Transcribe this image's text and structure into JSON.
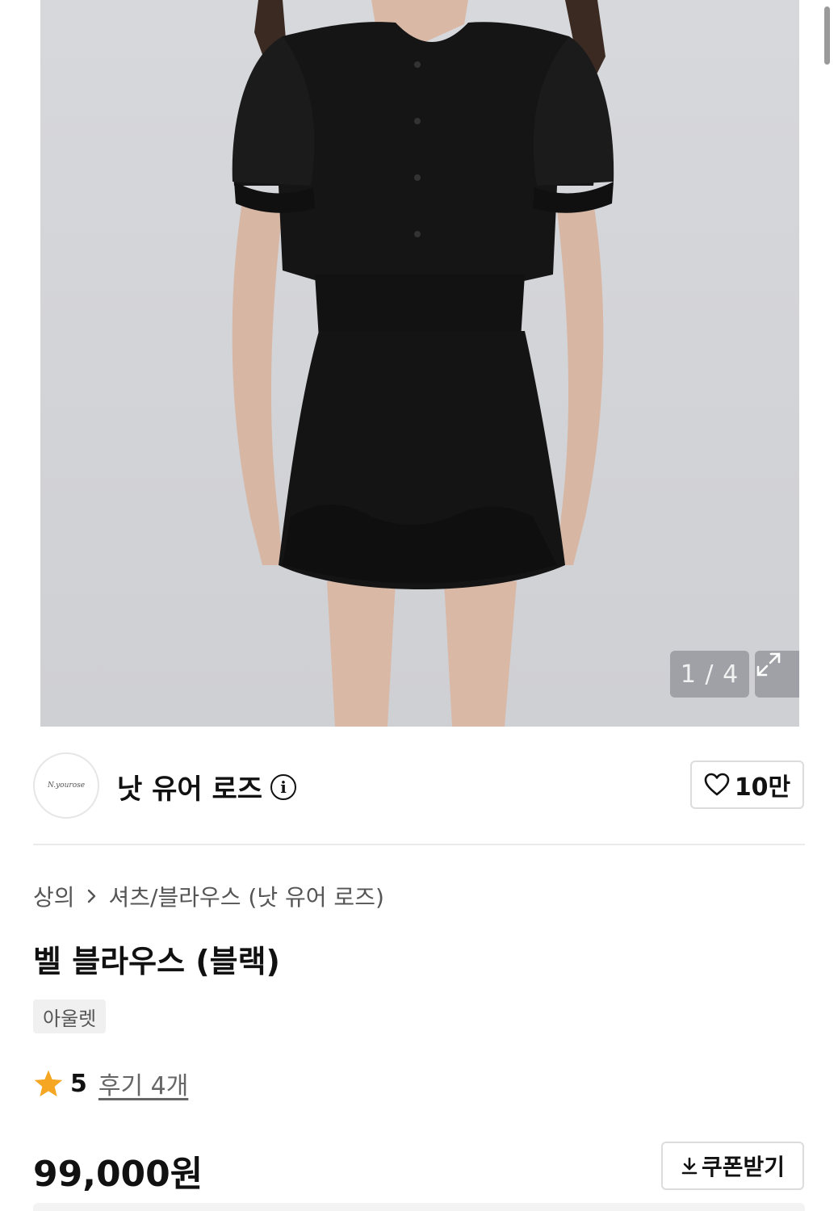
{
  "gallery": {
    "page_indicator": "1 / 4",
    "expand_icon": "expand-arrows-icon"
  },
  "brand": {
    "logo_text": "N.yourose",
    "name": "낫 유어 로즈",
    "info_icon": "info-icon",
    "likes": "10만",
    "like_icon": "heart-outline-icon"
  },
  "product": {
    "breadcrumb": [
      "상의",
      "셔츠/블라우스 (낫 유어 로즈)"
    ],
    "breadcrumb_separator_icon": "chevron-right-icon",
    "title": "벨 블라우스 (블랙)",
    "badge": "아울렛",
    "rating": "5",
    "rating_icon": "star-icon",
    "reviews": "후기 4개",
    "price": "99,000원",
    "coupon_label": "쿠폰받기",
    "coupon_icon": "download-icon"
  },
  "colors": {
    "star": "#F5A623",
    "text": "#111111",
    "muted": "#555555",
    "border": "#DCDCDC"
  }
}
